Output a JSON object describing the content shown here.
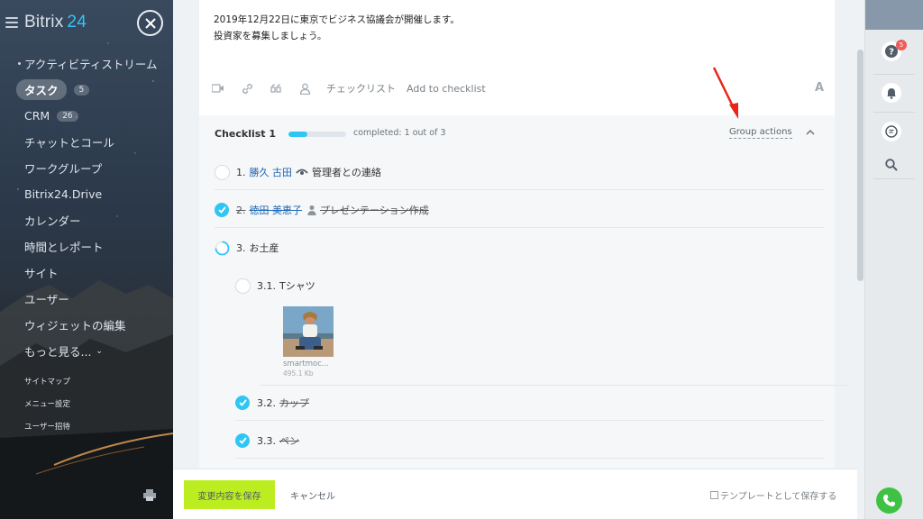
{
  "sidebar": {
    "logo_main": "Bitrix",
    "logo_num": "24",
    "items": [
      {
        "label": "アクティビティストリーム"
      },
      {
        "label": "タスク",
        "badge": "5"
      },
      {
        "label": "CRM",
        "badge": "26"
      },
      {
        "label": "チャットとコール"
      },
      {
        "label": "ワークグループ"
      },
      {
        "label": "Bitrix24.Drive"
      },
      {
        "label": "カレンダー"
      },
      {
        "label": "時間とレポート"
      },
      {
        "label": "サイト"
      },
      {
        "label": "ユーザー"
      },
      {
        "label": "ウィジェットの編集"
      },
      {
        "label": "もっと見る..."
      }
    ],
    "links": [
      "サイトマップ",
      "メニュー設定",
      "ユーザー招待"
    ]
  },
  "task": {
    "description_line1": "2019年12月22日に東京でビジネス協議会が開催します。",
    "description_line2": "投資家を募集しましょう。"
  },
  "toolbar": {
    "checklist_label": "チェックリスト",
    "add_checklist_label": "Add to checklist",
    "font_label": "A"
  },
  "checklist": {
    "title": "Checklist 1",
    "progress_done": 1,
    "progress_total": 3,
    "completed_text": "completed: 1 out of 3",
    "group_actions": "Group actions",
    "items": [
      {
        "num": "1.",
        "person": "勝久 古田",
        "text": "管理者との連絡",
        "state": "open"
      },
      {
        "num": "2.",
        "person": "徳田 美恵子",
        "text": "プレゼンテーション作成",
        "state": "done"
      },
      {
        "num": "3.",
        "text": "お土産",
        "state": "partial"
      }
    ],
    "subitems": [
      {
        "num": "3.1.",
        "text": "Tシャツ",
        "state": "open"
      },
      {
        "num": "3.2.",
        "text": "カップ",
        "state": "done"
      },
      {
        "num": "3.3.",
        "text": "ペン",
        "state": "done"
      }
    ],
    "attachment": {
      "name": "smartmoc...",
      "size": "495.1 Kb"
    }
  },
  "footer": {
    "save_label": "変更内容を保存",
    "cancel_label": "キャンセル",
    "template_label": "テンプレートとして保存する"
  },
  "rightbar": {
    "notification_badge": "5"
  },
  "colors": {
    "accent": "#2fc6f6",
    "save_button": "#bbed21",
    "link": "#2067b0",
    "annotation_arrow": "#e8251a"
  }
}
